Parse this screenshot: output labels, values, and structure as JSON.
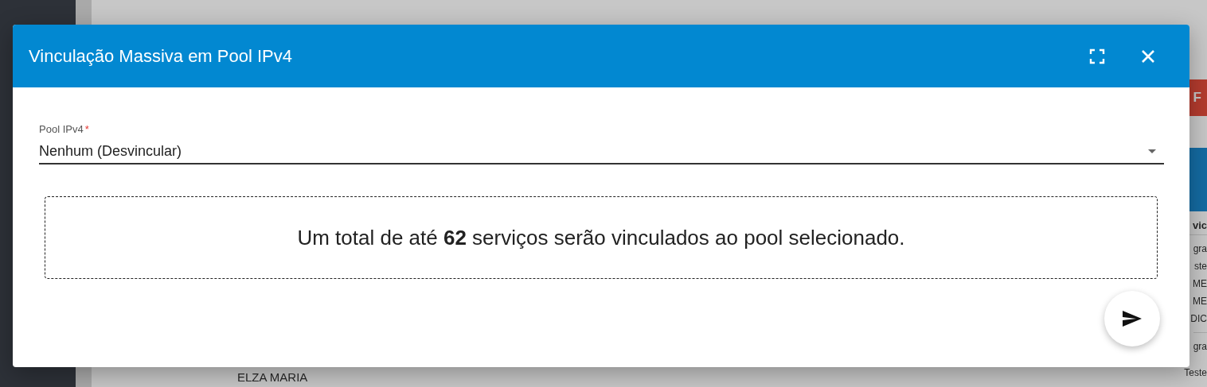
{
  "background": {
    "button_fragment": "F",
    "column_header_fragment": "vic",
    "cell_fragments": [
      "gra",
      "ste",
      "ME",
      "ME",
      "DIC",
      "gra",
      "Teste"
    ],
    "row_name": "ELZA MARIA"
  },
  "dialog": {
    "title": "Vinculação Massiva em Pool IPv4",
    "field": {
      "label": "Pool IPv4",
      "required_mark": "*",
      "value": "Nenhum (Desvincular)"
    },
    "message": "Um total de até **62** serviços serão vinculados ao pool selecionado."
  }
}
